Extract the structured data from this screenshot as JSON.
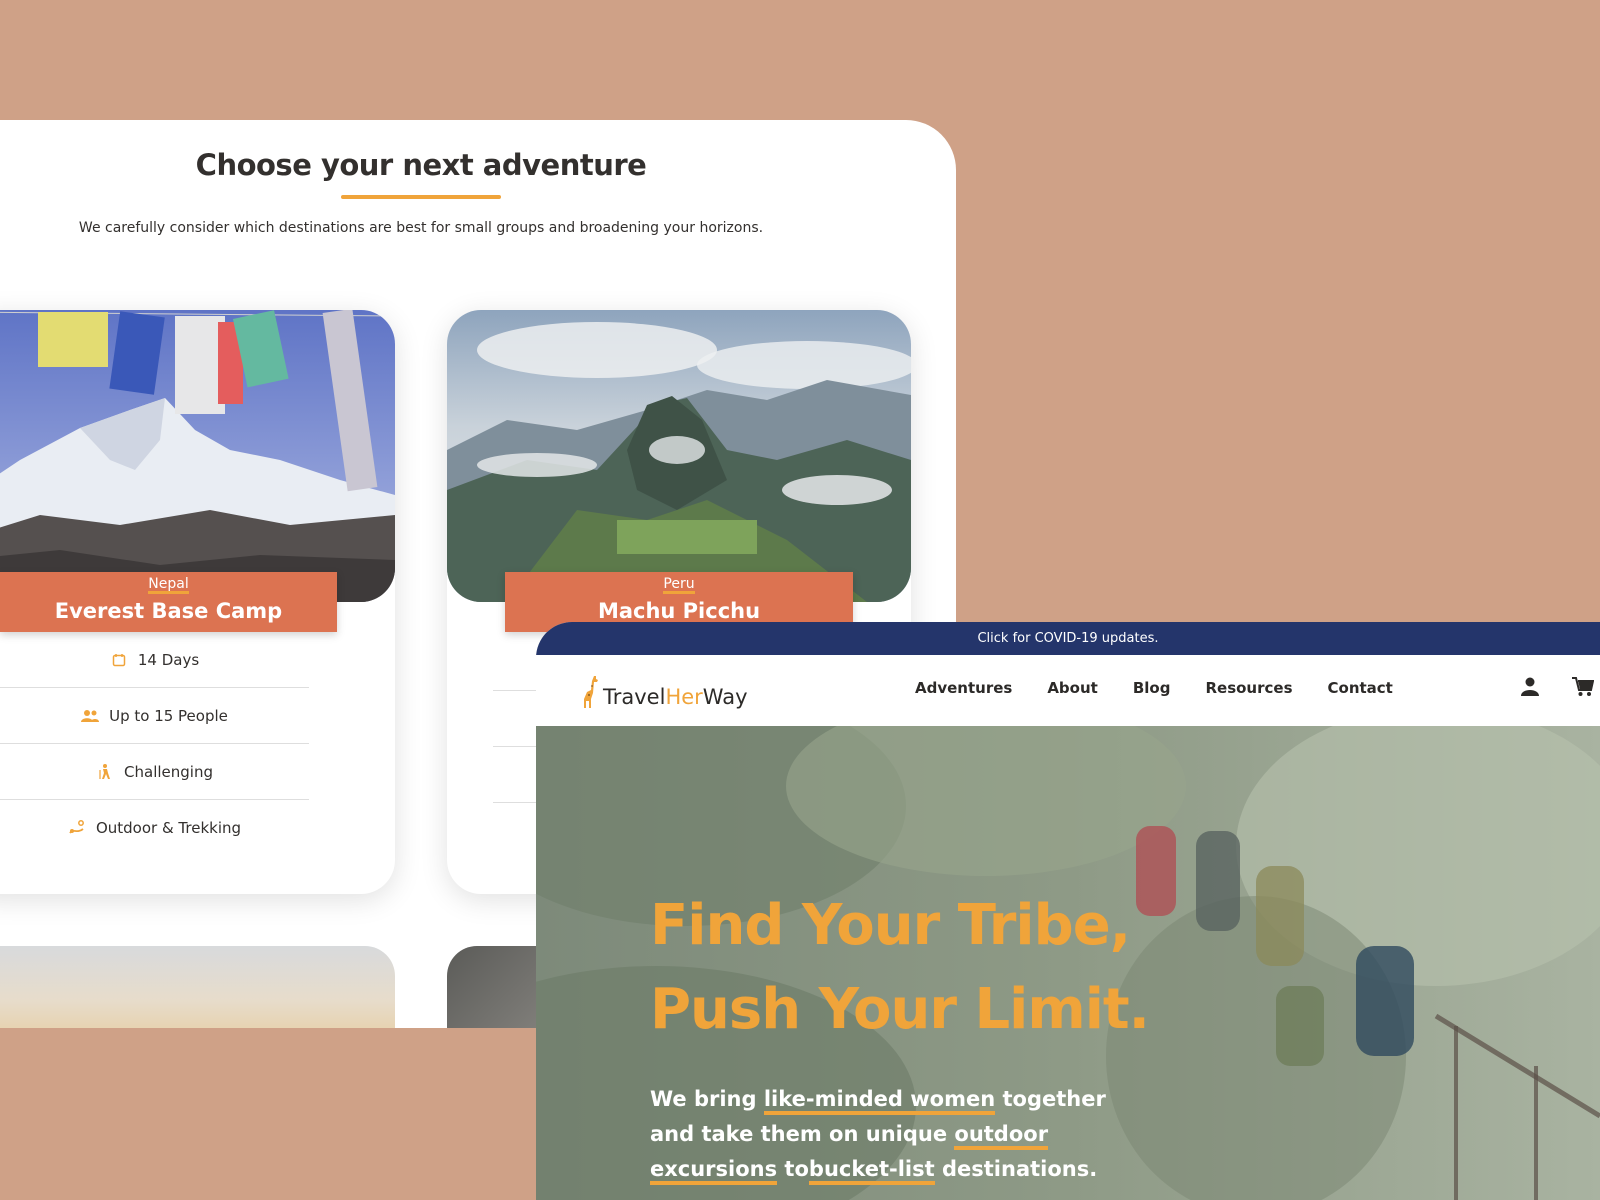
{
  "adventures": {
    "title": "Choose your next adventure",
    "subtitle": "We carefully consider which destinations are best for small groups and broadening your horizons.",
    "cards": [
      {
        "country": "Nepal",
        "name": "Everest Base Camp",
        "duration": "14 Days",
        "group_size": "Up to 15 People",
        "difficulty": "Challenging",
        "category": "Outdoor & Trekking"
      },
      {
        "country": "Peru",
        "name": "Machu Picchu"
      }
    ]
  },
  "banner": {
    "text": "Click for COVID-19 updates."
  },
  "logo": {
    "part1": "Travel",
    "part2": "Her",
    "part3": "Way"
  },
  "nav": {
    "links": [
      "Adventures",
      "About",
      "Blog",
      "Resources",
      "Contact"
    ]
  },
  "hero": {
    "title_line1": "Find Your Tribe,",
    "title_line2": "Push Your Limit.",
    "text_parts": [
      "We bring ",
      "like-minded women",
      " together and take them on unique ",
      "outdoor excursions",
      " to",
      "bucket-list",
      " destinations."
    ]
  },
  "colors": {
    "background": "#cfa187",
    "accent": "#f0a43a",
    "card_label": "#dc7351",
    "banner": "#24356b"
  },
  "icons": [
    "calendar-icon",
    "group-icon",
    "hiker-icon",
    "trekking-icon",
    "user-icon",
    "cart-icon",
    "giraffe-logo-icon"
  ]
}
